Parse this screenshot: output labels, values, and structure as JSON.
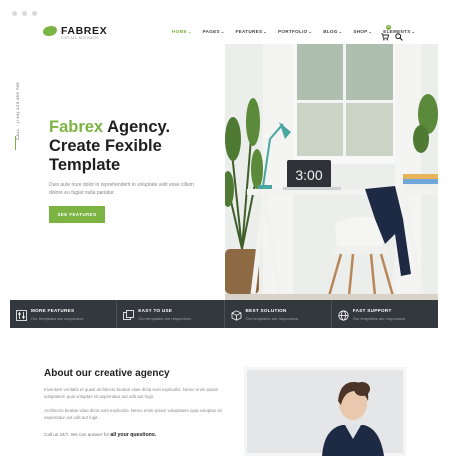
{
  "brand": {
    "name": "FABREX",
    "tagline": "FOR ALL BUSINESS",
    "accent": "#7cb342"
  },
  "nav": {
    "items": [
      {
        "label": "HOME",
        "active": true
      },
      {
        "label": "PAGES"
      },
      {
        "label": "FEATURES"
      },
      {
        "label": "PORTFOLIO"
      },
      {
        "label": "BLOG"
      },
      {
        "label": "SHOP"
      },
      {
        "label": "ELEMENTS"
      }
    ],
    "cart_count": "0",
    "icons": [
      "cart-icon",
      "search-icon"
    ]
  },
  "hero": {
    "call_text": "CALL : (+44) 123 456 789",
    "title_accent": "Fabrex",
    "title_line1_rest": " Agency.",
    "title_line2": "Create Fexible",
    "title_line3": "Template",
    "description": "Duis aute irure dolor in reprehenderit in voluptate velit esse cillum dolore eu fugiat nulla pariatur.",
    "button_label": "SEE FEATURES",
    "image_clock": "3:00"
  },
  "features": [
    {
      "title": "MORE FEATURES",
      "subtitle": "Our templates are responsive.",
      "icon": "sliders-icon"
    },
    {
      "title": "EASY TO USE",
      "subtitle": "Our templates are responsive.",
      "icon": "copy-icon"
    },
    {
      "title": "BEST SOLUTION",
      "subtitle": "Our templates are responsive.",
      "icon": "cube-icon"
    },
    {
      "title": "FAST SUPPORT",
      "subtitle": "Our templates are responsive.",
      "icon": "globe-icon"
    }
  ],
  "about": {
    "title": "About our creative agency",
    "paragraph1": "Inventore veritatis et quasi architecto beatae vitae dicta sunt explicabo. Nemo enim ipsam voluptatem quia voluptas sit aspernatur aut odit aut fugit.",
    "paragraph2": "Architecto beatae vitae dicta sunt explicabo. Nemo enim ipsam voluptatem quia voluptas sit aspernatur aut odit aut fugit.",
    "call_prefix": "Call us 24/7. We can answer for",
    "call_emphasis": "all your questions."
  }
}
